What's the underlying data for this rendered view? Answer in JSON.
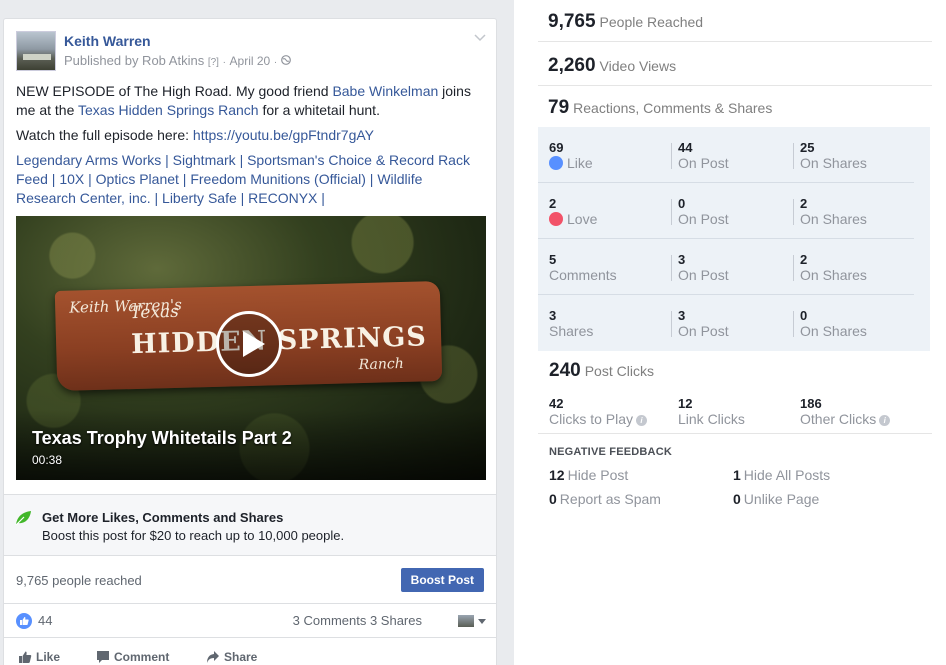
{
  "post": {
    "author": "Keith Warren",
    "published_by": "Published by Rob Atkins",
    "info_marker": "[?]",
    "date": "April 20",
    "text_line1_a": "NEW EPISODE of The High Road. My good friend ",
    "text_link_babe": "Babe Winkelman",
    "text_line1_b": " joins me at the ",
    "text_link_ranch": "Texas Hidden Springs Ranch",
    "text_line1_c": " for a whitetail hunt.",
    "watch_prefix": "Watch the full episode here: ",
    "watch_link": "https://youtu.be/gpFtndr7gAY",
    "tags": "Legendary Arms Works | Sightmark | Sportsman's Choice & Record Rack Feed | 10X | Optics Planet | Freedom Munitions (Official) | Wildlife Research Center, inc. | Liberty Safe | RECONYX |",
    "video": {
      "sign_line1": "Keith Warren's",
      "sign_line2": "Texas",
      "sign_line3": "HIDDEN SPRINGS",
      "sign_line4": "Ranch",
      "title": "Texas Trophy Whitetails Part 2",
      "duration": "00:38"
    },
    "boost": {
      "title": "Get More Likes, Comments and Shares",
      "subtitle": "Boost this post for $20 to reach up to 10,000 people."
    },
    "people_reached": "9,765 people reached",
    "boost_button": "Boost Post",
    "reaction_count": "44",
    "comments_shares": "3 Comments  3 Shares",
    "actions": {
      "like": "Like",
      "comment": "Comment",
      "share": "Share"
    }
  },
  "insights": {
    "people_reached": {
      "num": "9,765",
      "label": "People Reached"
    },
    "video_views": {
      "num": "2,260",
      "label": "Video Views"
    },
    "engagement": {
      "num": "79",
      "label": "Reactions, Comments & Shares"
    },
    "breakdown": [
      {
        "total": "69",
        "label": "Like",
        "on_post": "44",
        "on_post_label": "On Post",
        "on_shares": "25",
        "on_shares_label": "On Shares"
      },
      {
        "total": "2",
        "label": "Love",
        "on_post": "0",
        "on_post_label": "On Post",
        "on_shares": "2",
        "on_shares_label": "On Shares"
      },
      {
        "total": "5",
        "label": "Comments",
        "on_post": "3",
        "on_post_label": "On Post",
        "on_shares": "2",
        "on_shares_label": "On Shares"
      },
      {
        "total": "3",
        "label": "Shares",
        "on_post": "3",
        "on_post_label": "On Post",
        "on_shares": "0",
        "on_shares_label": "On Shares"
      }
    ],
    "post_clicks": {
      "num": "240",
      "label": "Post Clicks"
    },
    "clicks": [
      {
        "num": "42",
        "label": "Clicks to Play"
      },
      {
        "num": "12",
        "label": "Link Clicks"
      },
      {
        "num": "186",
        "label": "Other Clicks"
      }
    ],
    "negative_title": "NEGATIVE FEEDBACK",
    "negative": {
      "hide_post": {
        "num": "12",
        "label": "Hide Post"
      },
      "hide_all": {
        "num": "1",
        "label": "Hide All Posts"
      },
      "spam": {
        "num": "0",
        "label": "Report as Spam"
      },
      "unlike": {
        "num": "0",
        "label": "Unlike Page"
      }
    }
  },
  "colors": {
    "link": "#365899",
    "boost_button": "#4267b2",
    "like_blue": "#5890ff",
    "love_red": "#f25268",
    "grid_bg": "#edf2f7"
  }
}
